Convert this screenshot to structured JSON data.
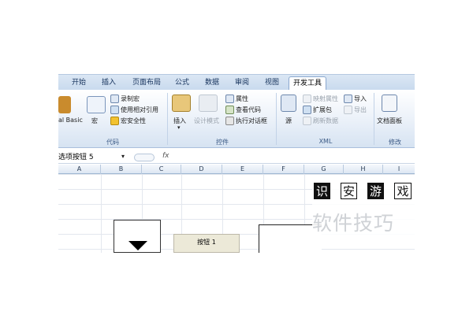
{
  "tabs": [
    "开始",
    "插入",
    "页面布局",
    "公式",
    "数据",
    "审阅",
    "视图",
    "开发工具"
  ],
  "active_tab": "开发工具",
  "groups": {
    "code": {
      "label": "代码",
      "visual_basic": "al Basic",
      "macro": "宏",
      "record_macro": "录制宏",
      "relative_ref": "使用相对引用",
      "macro_security": "宏安全性"
    },
    "controls": {
      "label": "控件",
      "insert": "插入",
      "design_mode": "设计模式",
      "properties": "属性",
      "view_code": "查看代码",
      "run_dialog": "执行对话框"
    },
    "xml": {
      "label": "XML",
      "source": "源",
      "map_properties": "映射属性",
      "expansion_packs": "扩展包",
      "refresh_data": "刷新数据",
      "import": "导入",
      "export": "导出"
    },
    "modify": {
      "label": "修改",
      "document_panel": "文档面板"
    }
  },
  "formula_bar": {
    "name_box": "选项按钮  5",
    "fx": "fx"
  },
  "columns": [
    "A",
    "B",
    "C",
    "D",
    "E",
    "F",
    "G",
    "H",
    "I"
  ],
  "sheet": {
    "button_label": "按钮 1"
  },
  "watermark": {
    "chars": [
      "识",
      "安",
      "游",
      "戏"
    ],
    "text": "软件技巧"
  },
  "colors": {
    "ribbon_accent": "#15325c",
    "tab_bg": "#c9daee"
  }
}
